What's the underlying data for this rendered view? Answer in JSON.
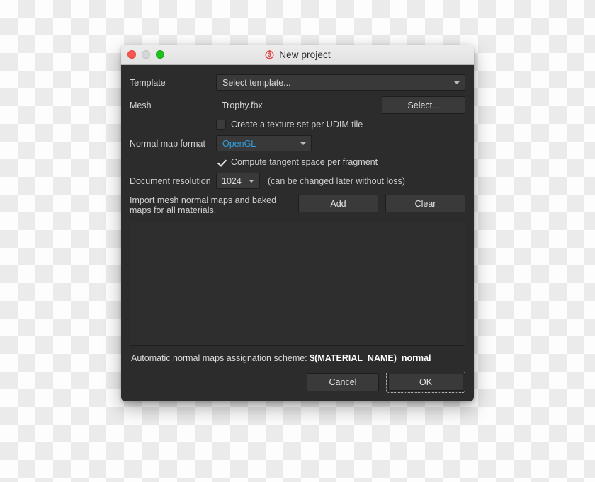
{
  "window": {
    "title": "New project",
    "icon": "substance-painter-logo-icon",
    "controls": {
      "close": "close-window-button",
      "minimize": "minimize-window-button",
      "maximize": "maximize-window-button"
    }
  },
  "form": {
    "template": {
      "label": "Template",
      "value": "Select template...",
      "icon": "chevron-down-icon"
    },
    "mesh": {
      "label": "Mesh",
      "filename": "Trophy.fbx",
      "select_button": "Select..."
    },
    "udim_checkbox": {
      "label": "Create a texture set per UDIM tile",
      "checked": false
    },
    "normal_map_format": {
      "label": "Normal map format",
      "value": "OpenGL",
      "value_color": "#2f9fe0"
    },
    "tangent_space_checkbox": {
      "label": "Compute tangent space per fragment",
      "checked": true
    },
    "document_resolution": {
      "label": "Document resolution",
      "value": "1024",
      "hint": "(can be changed later without loss)"
    },
    "import_maps": {
      "description": "Import mesh normal maps and baked maps for all materials.",
      "add_button": "Add",
      "clear_button": "Clear"
    },
    "maps_list": {
      "items": []
    }
  },
  "footer": {
    "scheme_label": "Automatic normal maps assignation scheme:",
    "scheme_value": "$(MATERIAL_NAME)_normal",
    "cancel_button": "Cancel",
    "ok_button": "OK"
  },
  "colors": {
    "dialog_background": "#2c2c2c",
    "titlebar_background": "#e8e8e8",
    "accent_blue": "#2f9fe0",
    "close_red": "#f9564f",
    "maximize_green": "#1ec11e",
    "minimize_gray": "#d6d6d6"
  }
}
